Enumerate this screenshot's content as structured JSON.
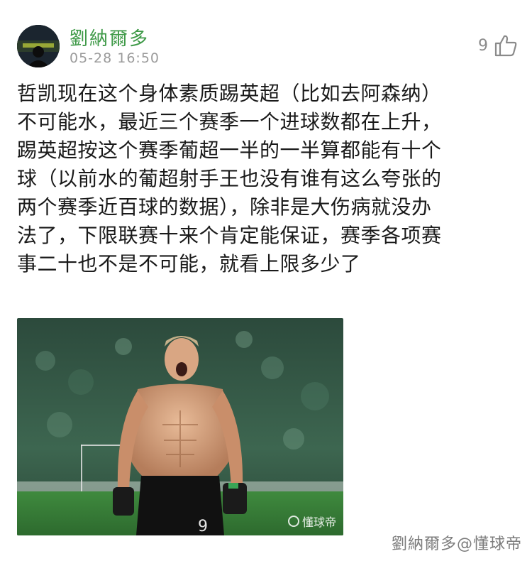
{
  "post": {
    "author": "劉納爾多",
    "timestamp": "05-28 16:50",
    "like_count": "9",
    "like_icon": "thumbs-up-icon",
    "text": "哲凯现在这个身体素质踢英超（比如去阿森纳）\n不可能水，最近三个赛季一个进球数都在上升，\n踢英超按这个赛季葡超一半的一半算都能有十个\n球（以前水的葡超射手王也没有谁有这么夸张的\n两个赛季近百球的数据），除非是大伤病就没办\n法了，下限联赛十来个肯定能保证，赛季各项赛\n事二十也不是不可能，就看上限多少了"
  },
  "photo": {
    "watermark": "懂球帝",
    "jersey_number": "9"
  },
  "footer": {
    "watermark": "劉納爾多@懂球帝"
  },
  "colors": {
    "author": "#3f9a48",
    "timestamp": "#9b9b9b",
    "text": "#1a1a1a"
  }
}
